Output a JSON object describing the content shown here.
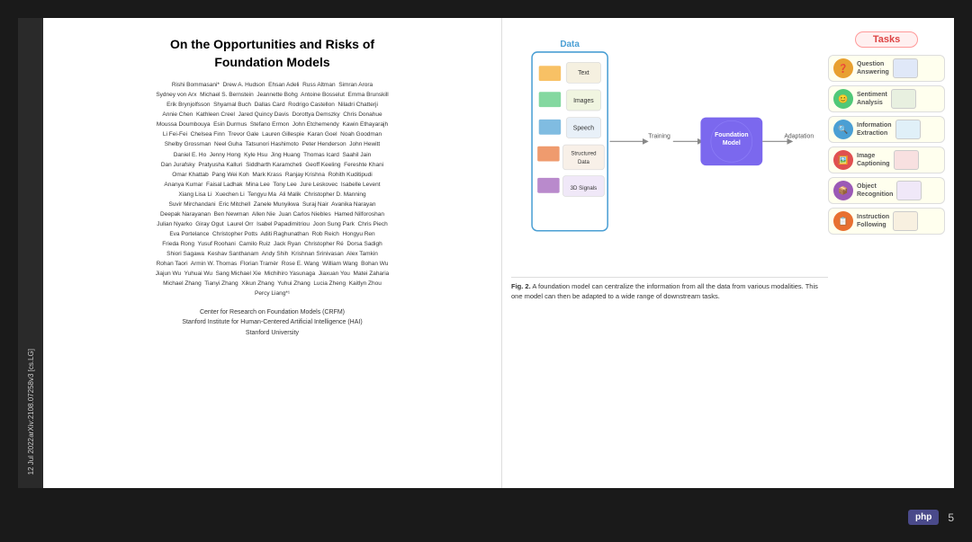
{
  "paper": {
    "title_line1": "On the Opportunities and Risks of",
    "title_line2": "Foundation Models",
    "authors": "Rishi Bommasani*  Drew A. Hudson  Ehsan Adeli  Russ Altman  Simran Arora\nSydney von Arx  Michael S. Bernstein  Jeannette Bohg  Antoine Bosselut  Emma Brunskill\nErik Brynjolfsson  Shyamal Buch  Dallas Card  Rodrigo Castellon  Niladri Chatterji\nAnnie Chen  Kathleen Creel  Jared Quincy Davis  Dorottya Demszky  Chris Donahue\nMoussa Doumbouya  Esin Durmus  Stefano Ermon  John Etchemendy  Kawin Ethayarajh\nLi Fei-Fei  Chelsea Finn  Trevor Gale  Lauren Gillespie  Karan Goel  Noah Goodman\nShelby Grossman  Neel Guha  Tatsunori Hashimoto  Peter Henderson  John Hewitt\nDaniel E. Ho  Jenny Hong  Kyle Hsu  Jing Huang  Thomas Icard  Saahil Jain\nDan Jurafsky  Pratyusha Kalluri  Siddharth Karamcheti  Geoff Keeling  Fereshte Khani\nOmar Khattab  Pang Wei Koh  Mark Krass  Ranjay Krishna  Rohith Kuditipudi\nAnanya Kumar  Faisal Ladhak  Mina Lee  Tony Lee  Jure Leskovec  Isabelle Levent\nXiang Lisa Li  Xuechen Li  Tengyu Ma  Ali Malik  Christopher D. Manning\nSuvir Mirchandani  Eric Mitchell  Zanele Munyikwa  Suraj Nair  Avanika Narayan\nDeeepak Narayanan  Ben Newman  Allen Nie  Juan Carlos Niebles  Hamed Nilforoshan\nJulian Nyarko  Giray Ogut  Laurel Orr  Isabel Papadimitriou  Joon Sung Park  Chris Piech\nEva Portelance  Christopher Potts  Aditi Raghunathan  Rob Reich  Hongyu Ren\nFrieda Rong  Yusuf Roohani  Camilo Ruiz  Jack Ryan  Christopher Ré  Dorsa Sadigh\nShiori Sagawa  Keshav Santhanam  Andy Shih  Krishnan Srinivasan  Alex Tamkin\nRohan Taori  Armin W. Thomas  Florian Tramèr  Rose E. Wang  William Wang  Bohan Wu\nJiajun Wu  Yuhuai Wu  Sang Michael Xie  Michihiro Yasunaga  Jiaxuan You  Matei Zaharia\nMichael Zhang  Tianyi Zhang  Xikun Zhang  Yuhui Zhang  Lucia Zheng  Kaitlyn Zhou\nPercy Liang*¹",
    "affiliation_line1": "Center for Research on Foundation Models (CRFM)",
    "affiliation_line2": "Stanford Institute for Human-Centered Artificial Intelligence (HAI)",
    "affiliation_line3": "Stanford University",
    "date_label": "12 Jul 2022",
    "arxiv_label": "arXiv:2108.07258v3  [cs.LG]"
  },
  "tasks": {
    "header": "Tasks",
    "items": [
      {
        "label": "Question\nAnswering",
        "color": "#e8a030"
      },
      {
        "label": "Sentiment\nAnalysis",
        "color": "#50c878"
      },
      {
        "label": "Information\nExtraction",
        "color": "#4a9fd4"
      },
      {
        "label": "Image\nCaptioning",
        "color": "#e05050"
      },
      {
        "label": "Object\nRecognition",
        "color": "#9b59b6"
      },
      {
        "label": "Instruction\nFollowing",
        "color": "#e87030"
      }
    ]
  },
  "diagram": {
    "data_label": "Data",
    "data_items": [
      "Text",
      "Images",
      "Speech",
      "Structured\nData",
      "3D Signals"
    ],
    "training_label": "Training",
    "foundation_label": "Foundation\nModel",
    "adaptation_label": "Adaptation"
  },
  "caption": {
    "fig_label": "Fig. 2.",
    "text": "A foundation model can centralize the information from all the data from various modalities. This one model can then be adapted to a wide range of downstream tasks."
  },
  "footer": {
    "php_label": "php",
    "page_number": "5"
  }
}
